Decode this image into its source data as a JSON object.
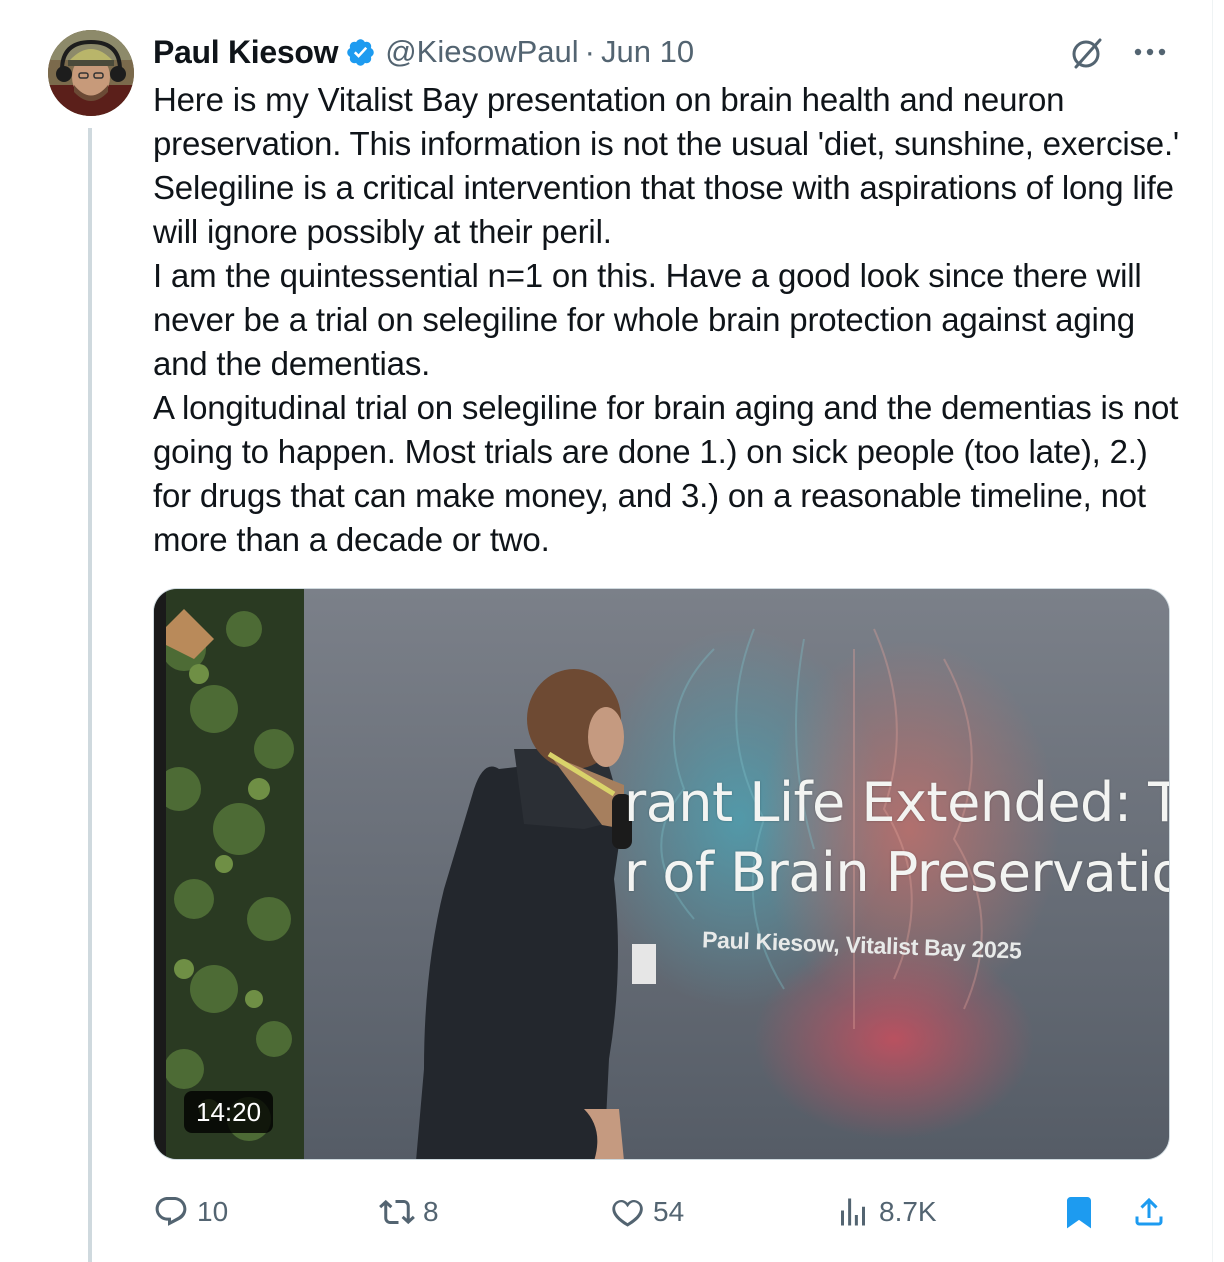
{
  "author": {
    "name": "Paul Kiesow",
    "handle": "@KiesowPaul",
    "separator": "·",
    "date": "Jun 10"
  },
  "tweet": {
    "paragraphs": [
      "Here is my Vitalist Bay presentation on brain health and neuron preservation. This information is not the usual 'diet, sunshine, exercise.' Selegiline is a critical intervention that those with aspirations of long life will ignore possibly at their peril.",
      "I am the quintessential n=1 on this. Have a good look since there will never be a trial on selegiline for whole brain protection against aging and the dementias.",
      "A longitudinal trial on selegiline for brain aging and the dementias is not going to happen. Most trials are done 1.) on sick people (too late), 2.) for drugs that can make money, and 3.) on a reasonable timeline, not more than a decade or two."
    ]
  },
  "video": {
    "slide_title_line1": "rant Life Extended: The",
    "slide_title_line2": "r of Brain Preservation",
    "slide_subtitle": "Paul Kiesow, Vitalist Bay 2025",
    "duration": "14:20"
  },
  "actions": {
    "replies": "10",
    "reposts": "8",
    "likes": "54",
    "views": "8.7K",
    "bookmarked": true
  },
  "colors": {
    "text": "#0f1419",
    "secondary": "#536471",
    "accent": "#1d9bf0",
    "thread_line": "#cfd9de"
  },
  "icons": [
    "verified-badge-icon",
    "grok-icon",
    "more-icon",
    "reply-icon",
    "repost-icon",
    "like-icon",
    "views-icon",
    "bookmark-icon",
    "share-icon"
  ]
}
